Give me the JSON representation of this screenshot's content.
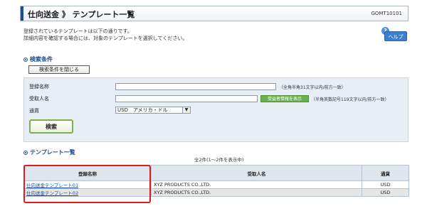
{
  "header": {
    "title": "仕向送金 》 テンプレート一覧",
    "screen_code": "GOMT10101"
  },
  "description": {
    "line1": "登録されているテンプレートは以下の通りです。",
    "line2": "詳細内容を確認する場合には、対象のテンプレートを選択してください。"
  },
  "help": {
    "question_mark": "?",
    "label": "ヘルプ"
  },
  "search": {
    "section_title": "検索条件",
    "close_label": "検索条件を閉じる",
    "reg_name_label": "登録名称",
    "reg_name_value": "",
    "reg_name_hint": "（全角半角31文字以内/前方一致）",
    "recipient_label": "受取人名",
    "recipient_value": "",
    "recipient_button": "受益者情報を表示",
    "recipient_hint": "（半角英数記号119文字以内/前方一致）",
    "currency_label": "通貨",
    "currency_selected": "USD　アメリカ・ドル",
    "search_button": "検索"
  },
  "list": {
    "section_title": "テンプレート一覧",
    "count_text": "全2件(1〜2件を表示中)",
    "columns": [
      "登録名称",
      "受取人名",
      "通貨"
    ],
    "rows": [
      {
        "name": "仕向送金テンプレート01",
        "recipient": "XYZ PRODUCTS CO.,LTD.",
        "currency": "USD"
      },
      {
        "name": "仕向送金テンプレート02",
        "recipient": "XYZ PRODUCTS CO.,LTD.",
        "currency": "USD"
      }
    ]
  },
  "colors": {
    "accent": "#1c4f8f",
    "highlight": "#e01b1b",
    "search_button_border": "#7fb04f",
    "recipient_button": "#6bb14d"
  }
}
